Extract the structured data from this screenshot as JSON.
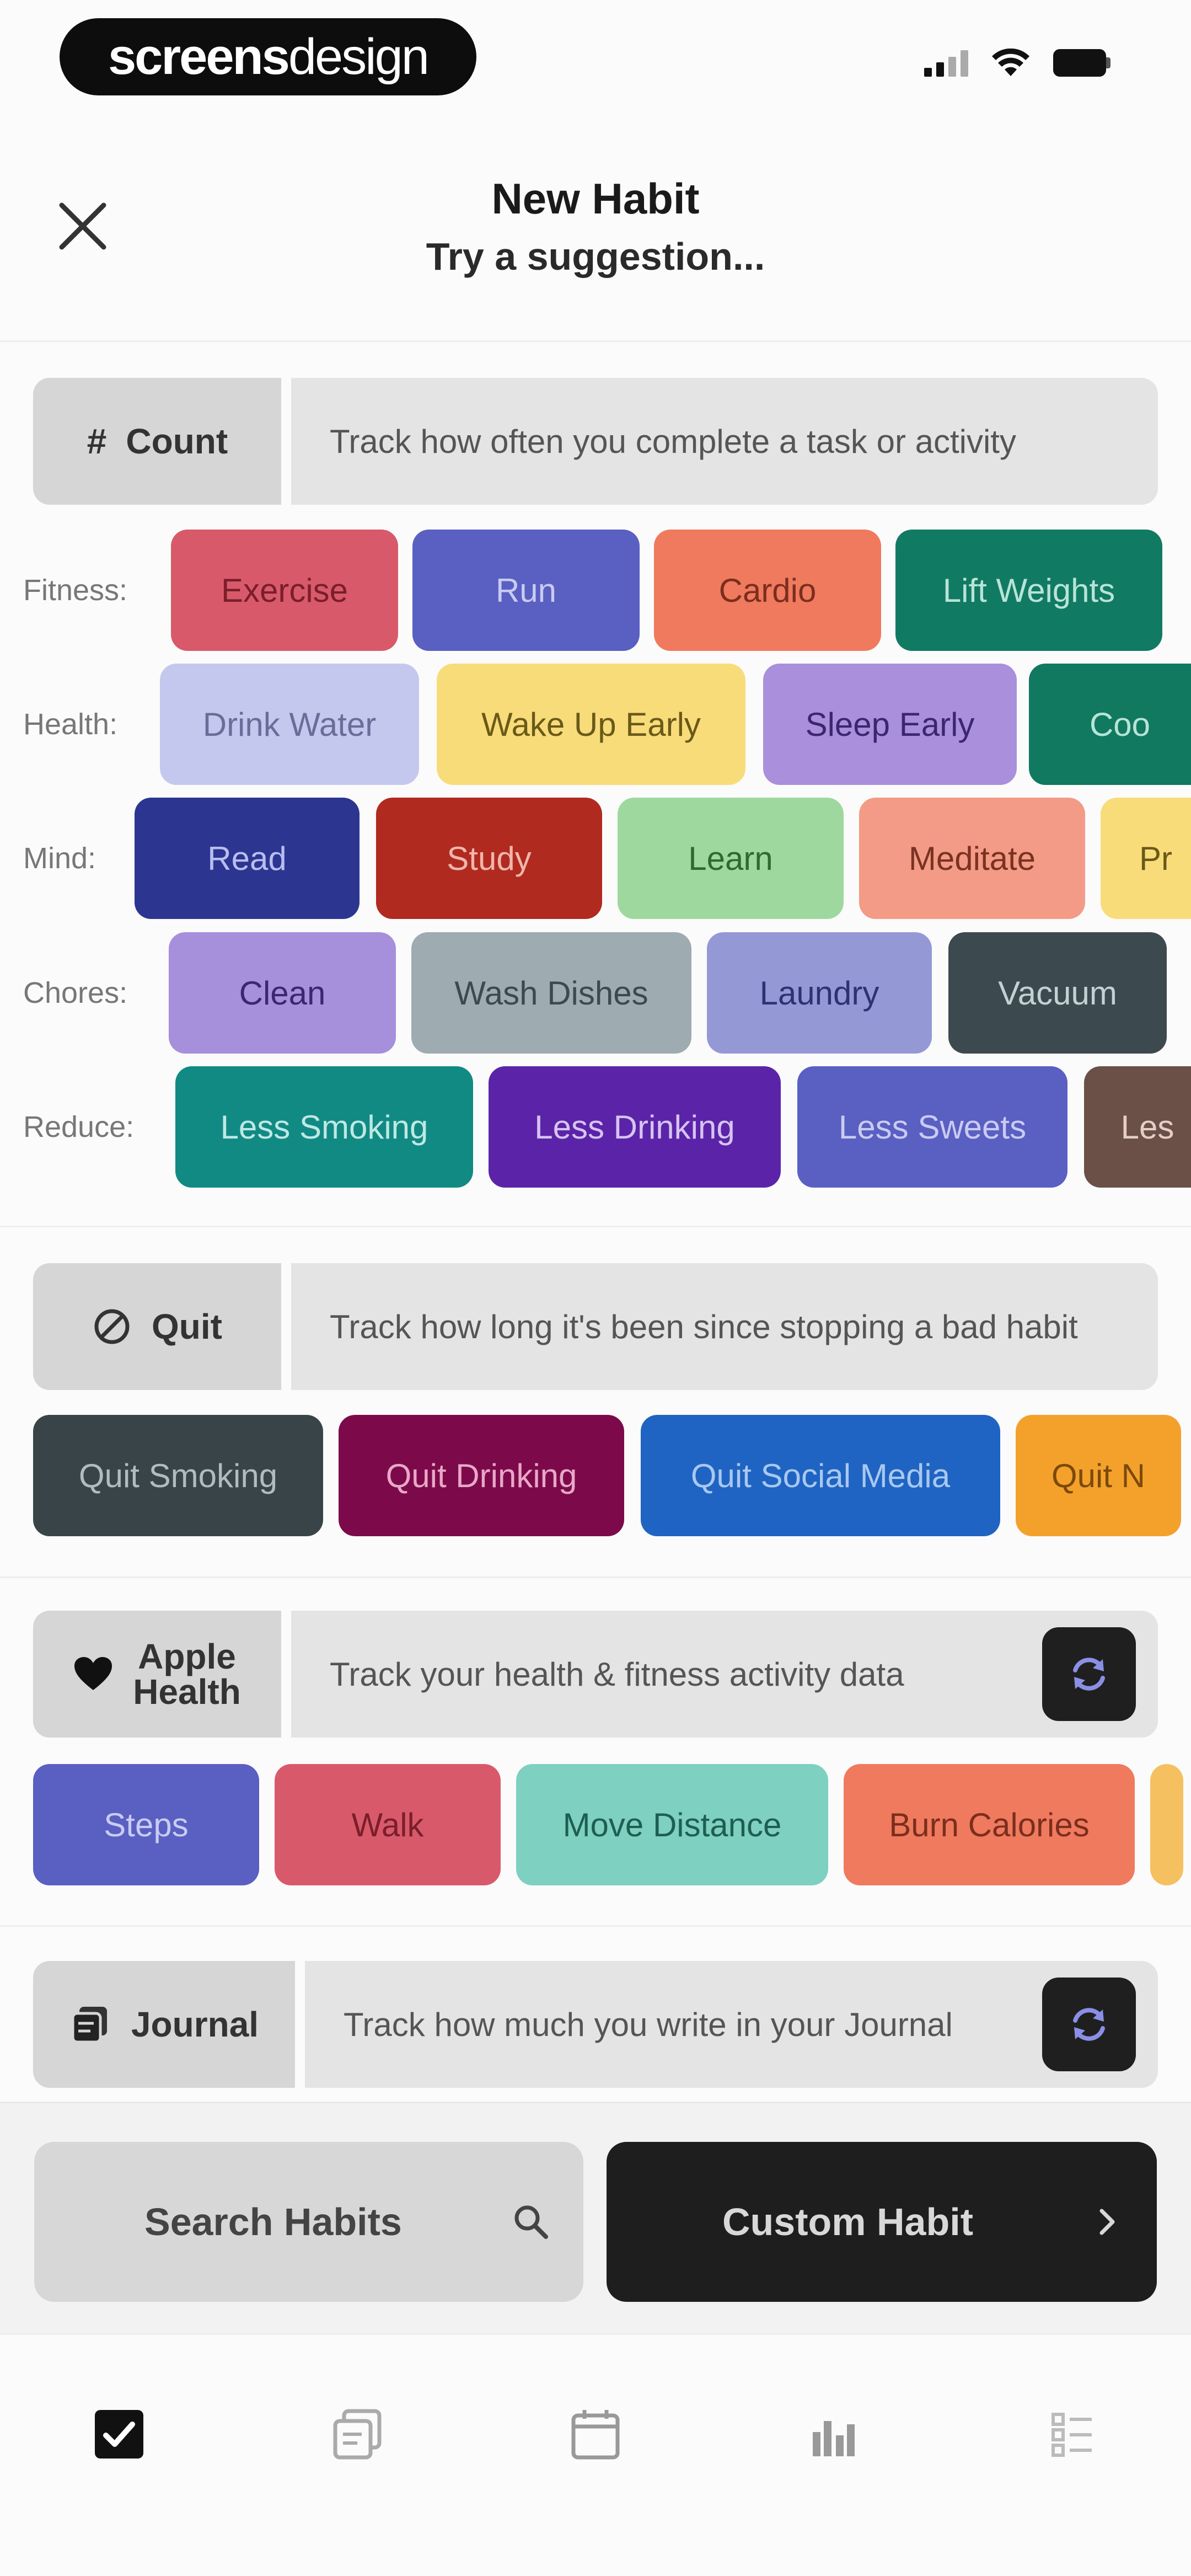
{
  "status_bar": {
    "brand_bold": "screens",
    "brand_light": "design"
  },
  "header": {
    "title": "New Habit",
    "subtitle": "Try a suggestion..."
  },
  "count": {
    "label": "Count",
    "icon": "hash-icon",
    "description": "Track how often you complete a task or activity",
    "rows": [
      {
        "label": "Fitness:",
        "chips": [
          {
            "label": "Exercise",
            "bg": "#d85a6a",
            "fg": "#7a1e2a"
          },
          {
            "label": "Run",
            "bg": "#5a5fc2",
            "fg": "#c9cbf2"
          },
          {
            "label": "Cardio",
            "bg": "#f07a5e",
            "fg": "#7a2e1e"
          },
          {
            "label": "Lift Weights",
            "bg": "#117a62",
            "fg": "#b8e4d8"
          }
        ]
      },
      {
        "label": "Health:",
        "chips": [
          {
            "label": "Drink Water",
            "bg": "#c5c8ee",
            "fg": "#6a6d99"
          },
          {
            "label": "Wake Up Early",
            "bg": "#f9dc7a",
            "fg": "#6a5a18"
          },
          {
            "label": "Sleep Early",
            "bg": "#a98fdc",
            "fg": "#3c2670"
          },
          {
            "label": "Coo",
            "bg": "#11795f",
            "fg": "#b8e4d8"
          }
        ]
      },
      {
        "label": "Mind:",
        "chips": [
          {
            "label": "Read",
            "bg": "#2c3590",
            "fg": "#b9bdf0"
          },
          {
            "label": "Study",
            "bg": "#b02a20",
            "fg": "#f0b6ad"
          },
          {
            "label": "Learn",
            "bg": "#9fd89e",
            "fg": "#2e6a2e"
          },
          {
            "label": "Meditate",
            "bg": "#f39b86",
            "fg": "#7a3222"
          },
          {
            "label": "Pr",
            "bg": "#f9dc7a",
            "fg": "#6a5a18"
          }
        ]
      },
      {
        "label": "Chores:",
        "chips": [
          {
            "label": "Clean",
            "bg": "#a68fdb",
            "fg": "#3c2670"
          },
          {
            "label": "Wash Dishes",
            "bg": "#9eabb0",
            "fg": "#3a4a50"
          },
          {
            "label": "Laundry",
            "bg": "#9499d6",
            "fg": "#2e3270"
          },
          {
            "label": "Vacuum",
            "bg": "#3c4a50",
            "fg": "#c5d0d4"
          }
        ]
      },
      {
        "label": "Reduce:",
        "chips": [
          {
            "label": "Less Smoking",
            "bg": "#118a84",
            "fg": "#bfe8e4"
          },
          {
            "label": "Less Drinking",
            "bg": "#5b24a8",
            "fg": "#d6c4f2"
          },
          {
            "label": "Less Sweets",
            "bg": "#5a5fc2",
            "fg": "#c9cbf2"
          },
          {
            "label": "Les",
            "bg": "#6b5048",
            "fg": "#e4cfc8"
          }
        ]
      }
    ]
  },
  "quit": {
    "label": "Quit",
    "icon": "no-symbol-icon",
    "description": "Track how long it's been since stopping a bad habit",
    "chips": [
      {
        "label": "Quit Smoking",
        "bg": "#384448",
        "fg": "#b0bcc0"
      },
      {
        "label": "Quit Drinking",
        "bg": "#7c0a4a",
        "fg": "#e8a8c8"
      },
      {
        "label": "Quit Social Media",
        "bg": "#1f64c2",
        "fg": "#a9c8f0"
      },
      {
        "label": "Quit N",
        "bg": "#f4a12c",
        "fg": "#7a4a0a"
      }
    ]
  },
  "apple_health": {
    "label": "Apple\nHealth",
    "icon": "heart-icon",
    "description": "Track your health & fitness activity data",
    "chips": [
      {
        "label": "Steps",
        "bg": "#5a5fc2",
        "fg": "#c9cbf2"
      },
      {
        "label": "Walk",
        "bg": "#d85a6a",
        "fg": "#7a1e2a"
      },
      {
        "label": "Move Distance",
        "bg": "#7ed0c0",
        "fg": "#1e5e52"
      },
      {
        "label": "Burn Calories",
        "bg": "#f07a5e",
        "fg": "#7a2e1e"
      },
      {
        "label": "",
        "bg": "#f4c060",
        "fg": "#6a4a10"
      }
    ]
  },
  "journal": {
    "label": "Journal",
    "icon": "journal-icon",
    "description": "Track how much you write in your Journal"
  },
  "actions": {
    "search": "Search Habits",
    "custom": "Custom Habit"
  },
  "tabs": [
    "checkbox-icon",
    "journal-icon",
    "calendar-icon",
    "stats-icon",
    "list-icon"
  ]
}
